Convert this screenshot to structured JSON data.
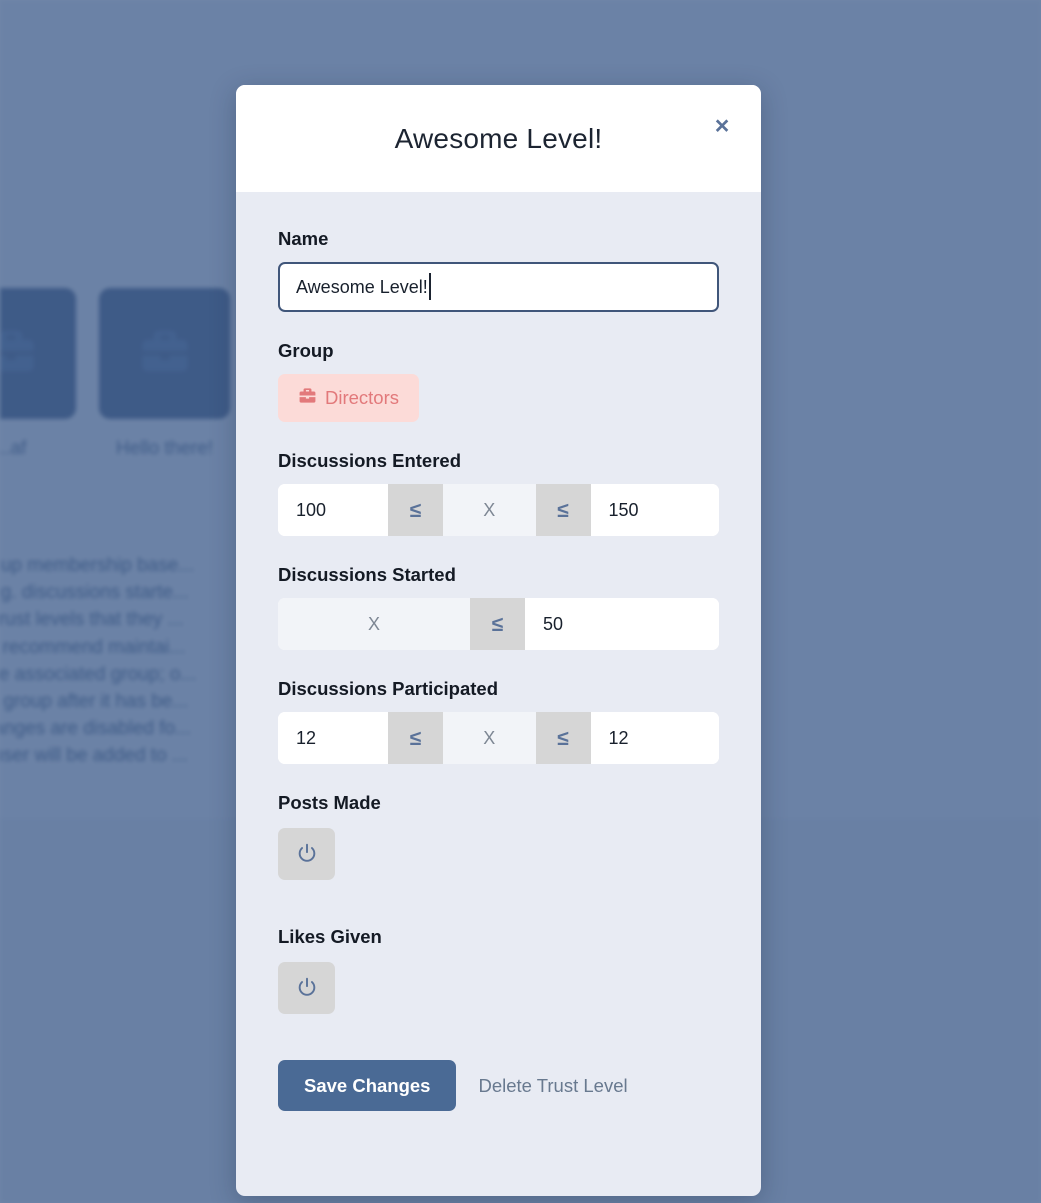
{
  "background": {
    "cards": [
      {
        "label": "...af",
        "icon": "briefcase-icon"
      },
      {
        "label": "Hello there!",
        "icon": "briefcase-icon"
      },
      {
        "label": "",
        "icon": "briefcase-icon"
      }
    ],
    "paragraph_lines": [
      "...nage group membership base...",
      "...e met (e.g. discussions starte...",
      "...r all the trust levels that they ...",
      "...cally, we recommend maintai...",
      "...delete the associated group; o...",
      "...st level's group after it has be...",
      "...d. If all ranges are disabled fo...",
      "...els, the user will be added to ..."
    ]
  },
  "modal": {
    "title": "Awesome Level!",
    "close_label": "×",
    "close_icon": "close-icon",
    "name": {
      "label": "Name",
      "value": "Awesome Level!",
      "placeholder": "Name"
    },
    "group": {
      "label": "Group",
      "badge_text": "Directors",
      "badge_icon": "briefcase-icon",
      "badge_bg": "#fcdbd8",
      "badge_fg": "#e2797b"
    },
    "ranges": [
      {
        "label": "Discussions Entered",
        "has_min": true,
        "min_value": "100",
        "min_operator": "≤",
        "variable": "X",
        "max_operator": "≤",
        "max_value": "150",
        "has_max": true
      },
      {
        "label": "Discussions Started",
        "has_min": false,
        "min_value": "",
        "min_operator": "",
        "variable": "X",
        "max_operator": "≤",
        "max_value": "50",
        "has_max": true
      },
      {
        "label": "Discussions Participated",
        "has_min": true,
        "min_value": "12",
        "min_operator": "≤",
        "variable": "X",
        "max_operator": "≤",
        "max_value": "12",
        "has_max": true
      }
    ],
    "toggles": [
      {
        "label": "Posts Made",
        "icon": "power-icon"
      },
      {
        "label": "Likes Given",
        "icon": "power-icon"
      }
    ],
    "actions": {
      "save_label": "Save Changes",
      "delete_label": "Delete Trust Level"
    }
  },
  "colors": {
    "scrim": "#5a7499",
    "modal_body": "#e8ebf3",
    "accent": "#4a6a95",
    "operator_bg": "#d6d6d6",
    "operator_fg": "#5a7299"
  }
}
